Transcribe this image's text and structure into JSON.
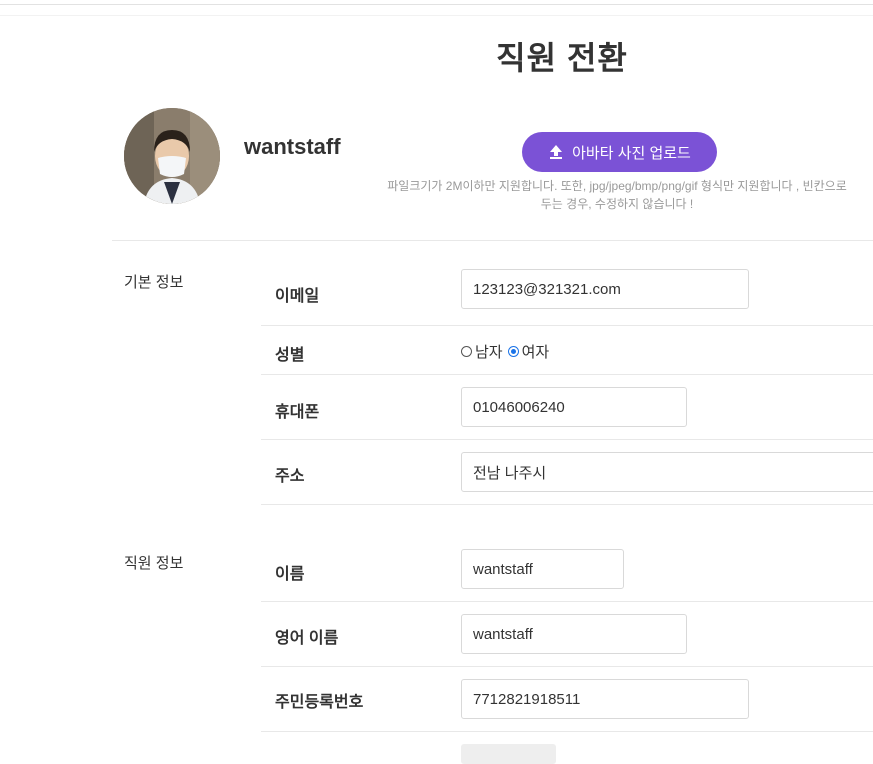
{
  "page_title": "직원 전환",
  "profile": {
    "username": "wantstaff",
    "upload_button_label": "아바타 사진 업로드",
    "upload_note_line1": "파일크기가 2M이하만 지원합니다. 또한, jpg/jpeg/bmp/png/gif 형식만 지원합니다 , 빈칸으로",
    "upload_note_line2": "두는 경우, 수정하지 않습니다 !"
  },
  "basic_info": {
    "section_label": "기본 정보",
    "email_label": "이메일",
    "email_value": "123123@321321.com",
    "gender_label": "성별",
    "gender_options": [
      "남자",
      "여자"
    ],
    "gender_selected": "여자",
    "phone_label": "휴대폰",
    "phone_value": "01046006240",
    "address_label": "주소",
    "address_value": "전남 나주시"
  },
  "staff_info": {
    "section_label": "직원 정보",
    "name_label": "이름",
    "name_value": "wantstaff",
    "english_name_label": "영어 이름",
    "english_name_value": "wantstaff",
    "resident_number_label": "주민등록번호",
    "resident_number_value": "7712821918511"
  },
  "colors": {
    "accent": "#7b52d6",
    "radio_selected": "#1a73e8"
  },
  "icons": {
    "upload": "upload-icon"
  }
}
